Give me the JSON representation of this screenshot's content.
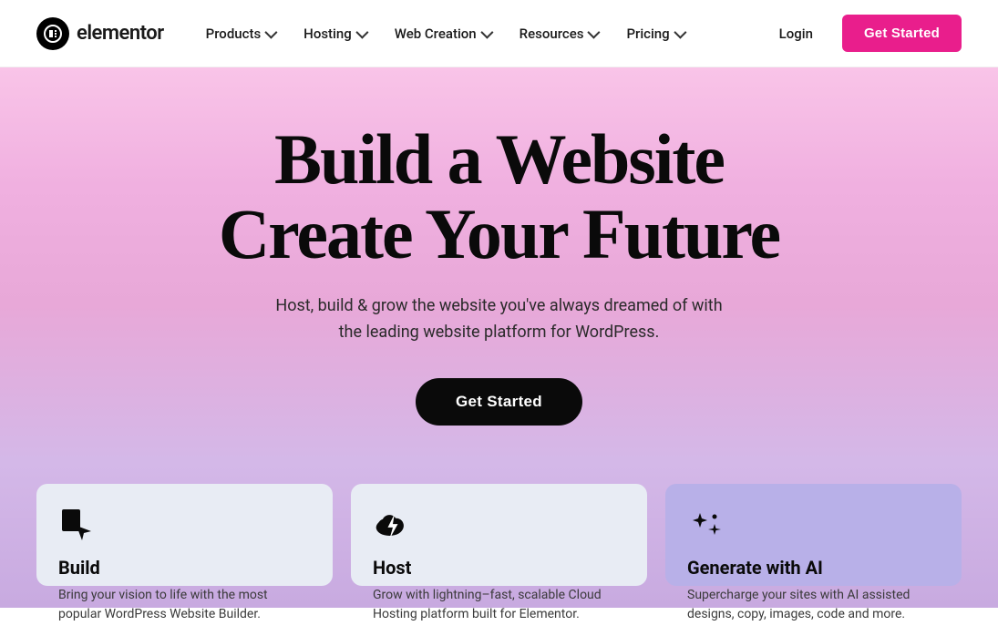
{
  "logo": {
    "text": "elementor",
    "aria": "Elementor homepage"
  },
  "navbar": {
    "links": [
      {
        "label": "Products",
        "has_dropdown": true
      },
      {
        "label": "Hosting",
        "has_dropdown": true
      },
      {
        "label": "Web Creation",
        "has_dropdown": true
      },
      {
        "label": "Resources",
        "has_dropdown": true
      },
      {
        "label": "Pricing",
        "has_dropdown": true
      }
    ],
    "login_label": "Login",
    "cta_label": "Get Started"
  },
  "hero": {
    "title_line1": "Build a Website",
    "title_line2": "Create Your Future",
    "subtitle": "Host, build & grow the website you've always dreamed of with the leading website platform for WordPress.",
    "cta_label": "Get Started"
  },
  "cards": [
    {
      "icon": "build-icon",
      "title": "Build",
      "description": "Bring your vision to life with the most popular WordPress Website Builder."
    },
    {
      "icon": "host-icon",
      "title": "Host",
      "description": "Grow with lightning–fast, scalable Cloud Hosting platform built for Elementor."
    },
    {
      "icon": "ai-icon",
      "title": "Generate with AI",
      "description": "Supercharge your sites with AI assisted designs, copy, images, code and more."
    }
  ],
  "colors": {
    "hero_gradient_start": "#f9c4e8",
    "hero_gradient_end": "#d4b8e8",
    "nav_cta_bg": "#e91e8c",
    "card_default_bg": "#e8ecf4",
    "card_ai_bg": "#b8b0e8",
    "hero_cta_bg": "#0a0a0a"
  }
}
